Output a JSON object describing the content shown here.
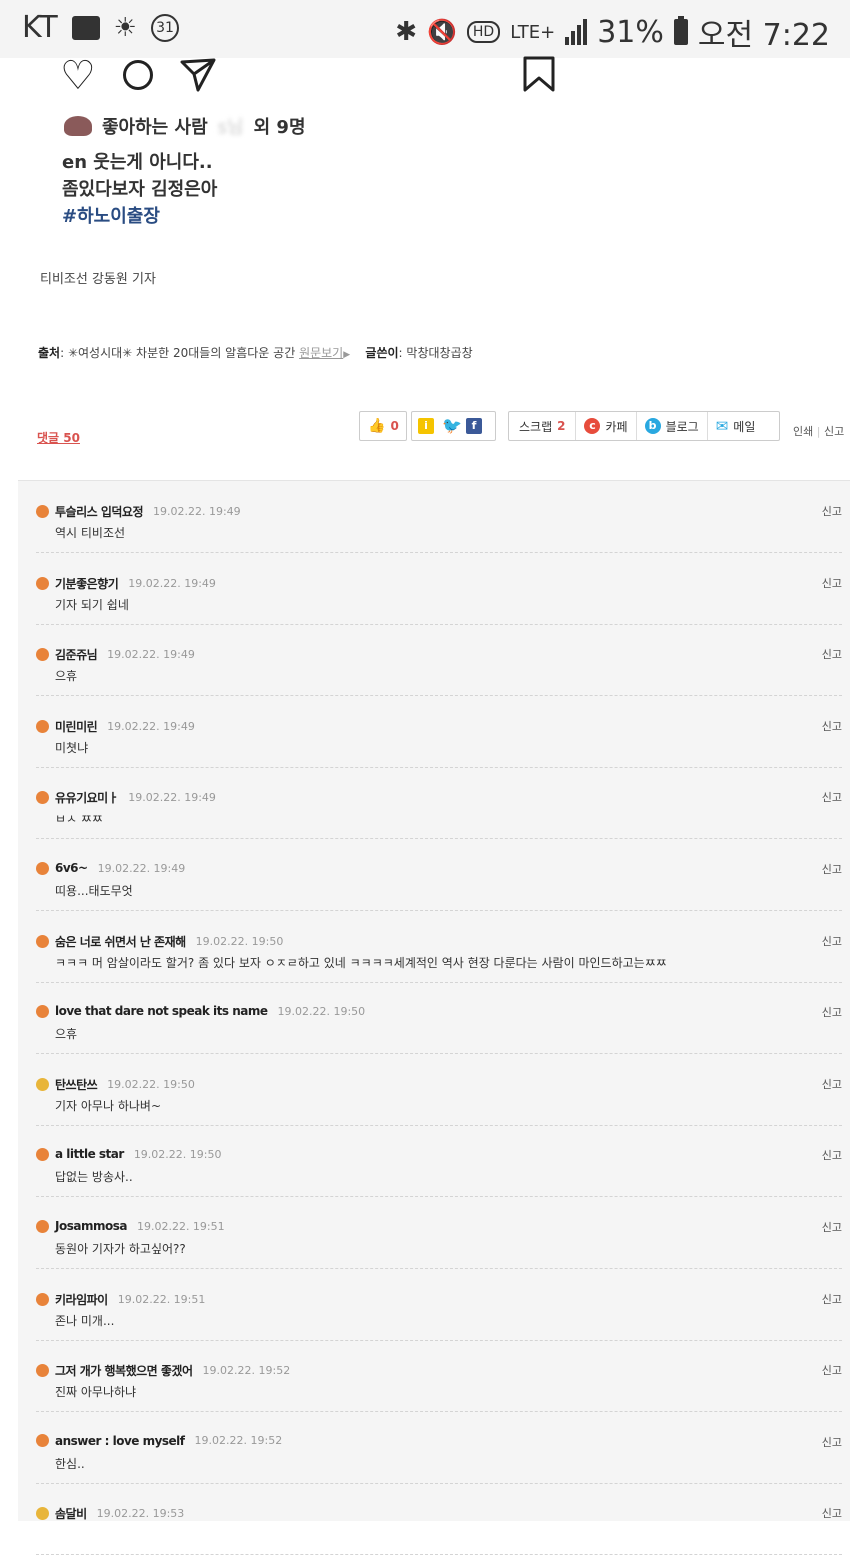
{
  "status_bar": {
    "carrier": "KT",
    "notification_count": "31",
    "network": "LTE+",
    "battery": "31%",
    "time": "오전 7:22"
  },
  "instagram": {
    "likes_text": "좋아하는 사람",
    "likes_blurred": "s님",
    "likes_suffix": "외 9명",
    "caption_line1": "en 웃는게 아니다..",
    "caption_line2": "좀있다보자 김정은아",
    "hashtag": "#하노이출장"
  },
  "article": {
    "reporter": "티비조선 강동원 기자",
    "source_label": "출처",
    "source_text": ": ✳︎여성시대✳︎ 차분한 20대들의 알흠다운 공간",
    "source_link": "원문보기",
    "author_label": "글쓴이",
    "author_text": ": 막창대창곱창"
  },
  "actions": {
    "comments_label": "댓글 50",
    "like_count": "0",
    "scrap_label": "스크랩",
    "scrap_count": "2",
    "cafe_label": "카페",
    "blog_label": "블로그",
    "mail_label": "메일",
    "print_label": "인쇄",
    "report_label": "신고"
  },
  "comments": [
    {
      "nick": "투슬리스 입덕요정",
      "time": "19.02.22. 19:49",
      "text": "역시 티비조선",
      "report": "신고",
      "gold": false
    },
    {
      "nick": "기분좋은향기",
      "time": "19.02.22. 19:49",
      "text": "기자 되기 쉽네",
      "report": "신고",
      "gold": false
    },
    {
      "nick": "김준쥬님",
      "time": "19.02.22. 19:49",
      "text": "으휴",
      "report": "신고",
      "gold": false
    },
    {
      "nick": "미린미린",
      "time": "19.02.22. 19:49",
      "text": "미쳣냐",
      "report": "신고",
      "gold": false
    },
    {
      "nick": "유유기요미ㅏ",
      "time": "19.02.22. 19:49",
      "text": "ㅂㅅ ㅉㅉ",
      "report": "신고",
      "gold": false
    },
    {
      "nick": "6v6~",
      "time": "19.02.22. 19:49",
      "text": "띠용...태도무엇",
      "report": "신고",
      "gold": false
    },
    {
      "nick": "숨은 너로 쉬면서 난 존재해",
      "time": "19.02.22. 19:50",
      "text": "ㅋㅋㅋ 머 암살이라도 할거? 좀 있다 보자 ㅇㅈㄹ하고 있네 ㅋㅋㅋㅋ세계적인 역사 현장 다룬다는 사람이 마인드하고는ㅉㅉ",
      "report": "신고",
      "gold": false
    },
    {
      "nick": "love that dare not speak its name",
      "time": "19.02.22. 19:50",
      "text": "으휴",
      "report": "신고",
      "gold": false
    },
    {
      "nick": "탄쓰탄쓰",
      "time": "19.02.22. 19:50",
      "text": "기자 아무나 하나벼~",
      "report": "신고",
      "gold": true
    },
    {
      "nick": "a little star",
      "time": "19.02.22. 19:50",
      "text": "답없는 방송사..",
      "report": "신고",
      "gold": false
    },
    {
      "nick": "Josammosa",
      "time": "19.02.22. 19:51",
      "text": "동원아 기자가 하고싶어??",
      "report": "신고",
      "gold": false
    },
    {
      "nick": "키라임파이",
      "time": "19.02.22. 19:51",
      "text": "존나 미개...",
      "report": "신고",
      "gold": false
    },
    {
      "nick": "그저 개가 행복했으면 좋겠어",
      "time": "19.02.22. 19:52",
      "text": "진짜 아무나하냐",
      "report": "신고",
      "gold": false
    },
    {
      "nick": "answer : love myself",
      "time": "19.02.22. 19:52",
      "text": "한심..",
      "report": "신고",
      "gold": false
    },
    {
      "nick": "솜달비",
      "time": "19.02.22. 19:53",
      "text": "",
      "report": "신고",
      "gold": true
    }
  ]
}
